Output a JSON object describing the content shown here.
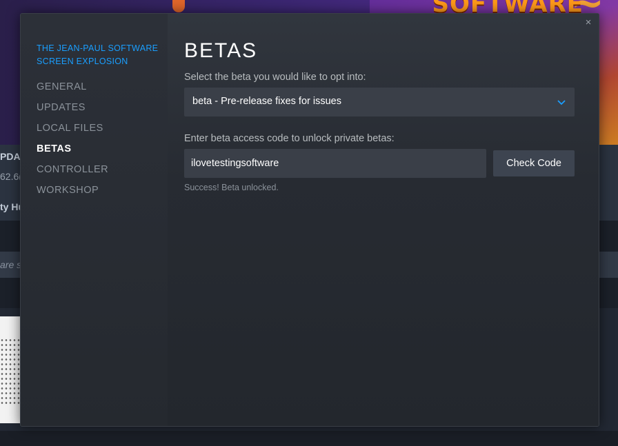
{
  "background": {
    "band_texts": [
      "PDA",
      "62.6(",
      "ty Hu"
    ],
    "strip_text": "are s"
  },
  "dialog": {
    "game_title": "THE JEAN-PAUL SOFTWARE SCREEN EXPLOSION",
    "close_icon": "×",
    "nav": [
      {
        "label": "GENERAL",
        "active": false
      },
      {
        "label": "UPDATES",
        "active": false
      },
      {
        "label": "LOCAL FILES",
        "active": false
      },
      {
        "label": "BETAS",
        "active": true
      },
      {
        "label": "CONTROLLER",
        "active": false
      },
      {
        "label": "WORKSHOP",
        "active": false
      }
    ],
    "page_title": "BETAS",
    "beta_select_label": "Select the beta you would like to opt into:",
    "beta_selected": "beta - Pre-release fixes for issues",
    "access_code_label": "Enter beta access code to unlock private betas:",
    "access_code_value": "ilovetestingsoftware",
    "check_code_button": "Check Code",
    "status_message": "Success! Beta unlocked."
  },
  "colors": {
    "accent": "#1a9fff",
    "dialog_bg": "#25292f",
    "input_bg": "#3a3f48"
  }
}
